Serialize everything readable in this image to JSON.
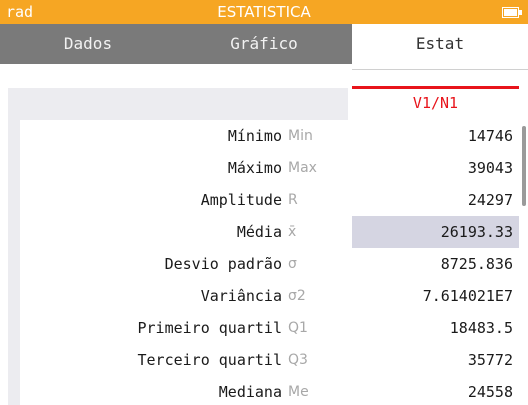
{
  "statusbar": {
    "mode": "rad",
    "title": "ESTATISTICA",
    "battery_icon": "battery-icon"
  },
  "tabs": [
    {
      "label": "Dados"
    },
    {
      "label": "Gráfico"
    },
    {
      "label": "Estat"
    }
  ],
  "column_header": "V1/N1",
  "rows": [
    {
      "name": "Mínimo",
      "sym": "Min",
      "value": "14746"
    },
    {
      "name": "Máximo",
      "sym": "Max",
      "value": "39043"
    },
    {
      "name": "Amplitude",
      "sym": "R",
      "value": "24297"
    },
    {
      "name": "Média",
      "sym": "x̄",
      "value": "26193.33"
    },
    {
      "name": "Desvio padrão",
      "sym": "σ",
      "value": "8725.836"
    },
    {
      "name": "Variância",
      "sym": "σ2",
      "value": "7.614021E7"
    },
    {
      "name": "Primeiro quartil",
      "sym": "Q1",
      "value": "18483.5"
    },
    {
      "name": "Terceiro quartil",
      "sym": "Q3",
      "value": "35772"
    },
    {
      "name": "Mediana",
      "sym": "Me",
      "value": "24558"
    }
  ],
  "colors": {
    "accent": "#f6a623",
    "header_red": "#e8141b",
    "selected_row": "#d5d5e2",
    "tab_dark": "#7a7a7a"
  }
}
